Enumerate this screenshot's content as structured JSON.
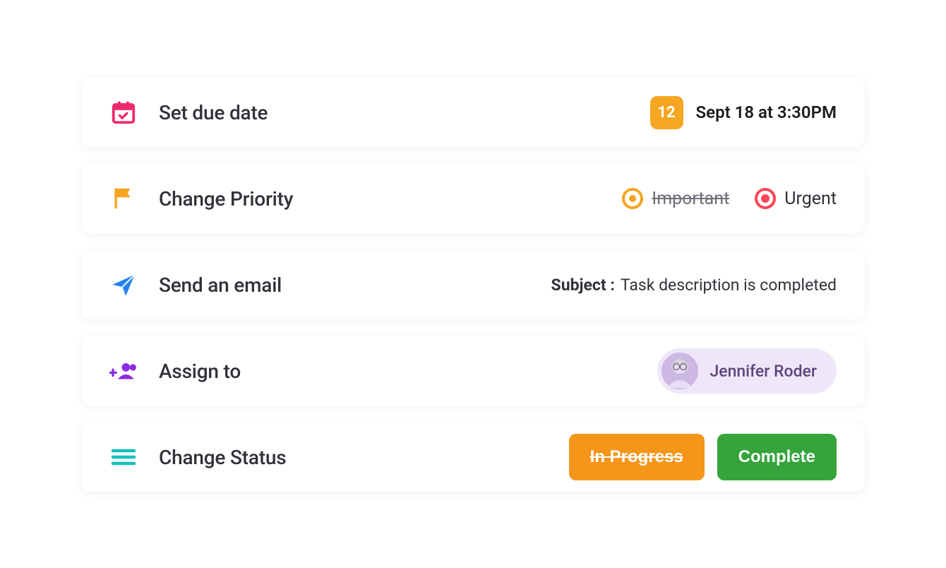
{
  "rows": {
    "dueDate": {
      "title": "Set due date",
      "badge": "12",
      "text": "Sept 18 at 3:30PM"
    },
    "priority": {
      "title": "Change Priority",
      "options": [
        {
          "label": "Important",
          "strikethrough": true
        },
        {
          "label": "Urgent",
          "strikethrough": false
        }
      ]
    },
    "email": {
      "title": "Send an email",
      "subjectLabel": "Subject :",
      "subjectText": "Task description is completed"
    },
    "assign": {
      "title": "Assign to",
      "assignee": "Jennifer Roder"
    },
    "status": {
      "title": "Change Status",
      "buttons": [
        {
          "label": "In Progress",
          "strikethrough": true
        },
        {
          "label": "Complete",
          "strikethrough": false
        }
      ]
    }
  },
  "colors": {
    "pink": "#ee2a6e",
    "amber": "#f5a623",
    "blue": "#2583f0",
    "purple": "#8a2be2",
    "teal": "#17c0bb",
    "orange": "#f5951a",
    "green": "#35a43b",
    "red": "#fa4659"
  }
}
